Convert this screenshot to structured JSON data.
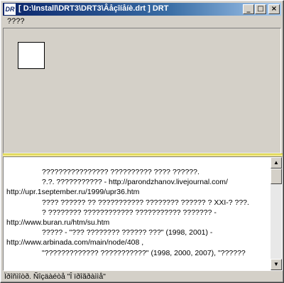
{
  "window": {
    "title": "[ D:\\Install\\DRT3\\DRT3\\Âåçîíåíè.drt ] DRT",
    "app_icon_label": "DR"
  },
  "title_buttons": {
    "minimize": "_",
    "maximize": "□",
    "close": "×"
  },
  "menu": {
    "items": [
      "????"
    ]
  },
  "text_lines": [
    "???????????????? ?????????? ???? ??????.",
    "?.?. ??????????? - http://parondzhanov.livejournal.com/",
    "http://upr.1september.ru/1999/upr36.htm",
    "???? ?????? ?? ??????????? ???????? ?????? ? XXI-? ???.",
    "? ???????? ???????????? ??????????? ??????? -",
    "http://www.buran.ru/htm/su.htm",
    "????? - \"??? ???????? ?????? ???\" (1998, 2001) -",
    "http://www.arbinada.com/main/node/408 ,",
    "\"????????????? ???????????\" (1998, 2000, 2007), \"??????"
  ],
  "text_indent": [
    true,
    true,
    false,
    true,
    true,
    false,
    true,
    false,
    true
  ],
  "scrollbar": {
    "up": "▲",
    "down": "▼"
  },
  "status": {
    "text": "Ïðîñìîòð. Ñîçäàéòå \"Î ïðîãðàììå\""
  }
}
